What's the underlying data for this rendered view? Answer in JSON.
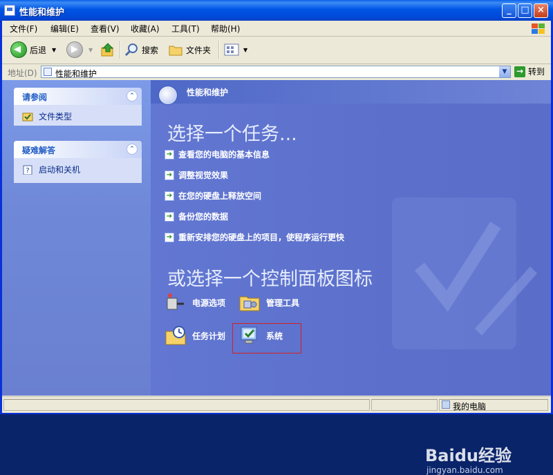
{
  "window": {
    "title": "性能和维护"
  },
  "menu": [
    "文件(F)",
    "编辑(E)",
    "查看(V)",
    "收藏(A)",
    "工具(T)",
    "帮助(H)"
  ],
  "toolbar": {
    "back_label": "后退",
    "search_label": "搜索",
    "folders_label": "文件夹"
  },
  "address": {
    "label": "地址(D)",
    "value": "性能和维护",
    "go_label": "转到"
  },
  "sidebar": {
    "panels": [
      {
        "title": "请参阅",
        "items": [
          {
            "label": "文件类型",
            "icon": "file-types-icon"
          }
        ]
      },
      {
        "title": "疑难解答",
        "items": [
          {
            "label": "启动和关机",
            "icon": "help-icon"
          }
        ]
      }
    ]
  },
  "main": {
    "banner_title": "性能和维护",
    "task_heading": "选择一个任务...",
    "tasks": [
      "查看您的电脑的基本信息",
      "调整视觉效果",
      "在您的硬盘上释放空间",
      "备份您的数据",
      "重新安排您的硬盘上的项目，使程序运行更快"
    ],
    "icons_heading": "或选择一个控制面板图标",
    "icons": [
      {
        "label": "电源选项",
        "icon": "power-options-icon"
      },
      {
        "label": "管理工具",
        "icon": "admin-tools-icon"
      },
      {
        "label": "任务计划",
        "icon": "scheduled-tasks-icon"
      },
      {
        "label": "系统",
        "icon": "system-icon"
      }
    ]
  },
  "status": {
    "right_text": "我的电脑"
  },
  "watermark": {
    "logo": "Baidu经验",
    "url": "jingyan.baidu.com"
  },
  "colors": {
    "accent": "#0055e5",
    "highlight": "#d42020",
    "panel_link": "#0c2b8a"
  }
}
